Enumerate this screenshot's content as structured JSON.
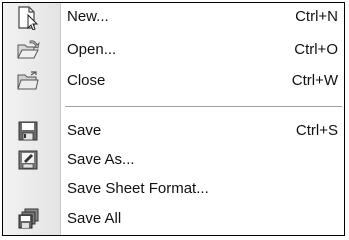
{
  "menu": {
    "items": [
      {
        "label": "New...",
        "shortcut": "Ctrl+N",
        "icon": "new-document-icon"
      },
      {
        "label": "Open...",
        "shortcut": "Ctrl+O",
        "icon": "open-folder-icon"
      },
      {
        "label": "Close",
        "shortcut": "Ctrl+W",
        "icon": "close-folder-icon"
      },
      {
        "label": "Save",
        "shortcut": "Ctrl+S",
        "icon": "save-disk-icon"
      },
      {
        "label": "Save As...",
        "shortcut": "",
        "icon": "save-as-icon"
      },
      {
        "label": "Save Sheet Format...",
        "shortcut": "",
        "icon": ""
      },
      {
        "label": "Save All",
        "shortcut": "",
        "icon": "save-all-icon"
      }
    ]
  }
}
